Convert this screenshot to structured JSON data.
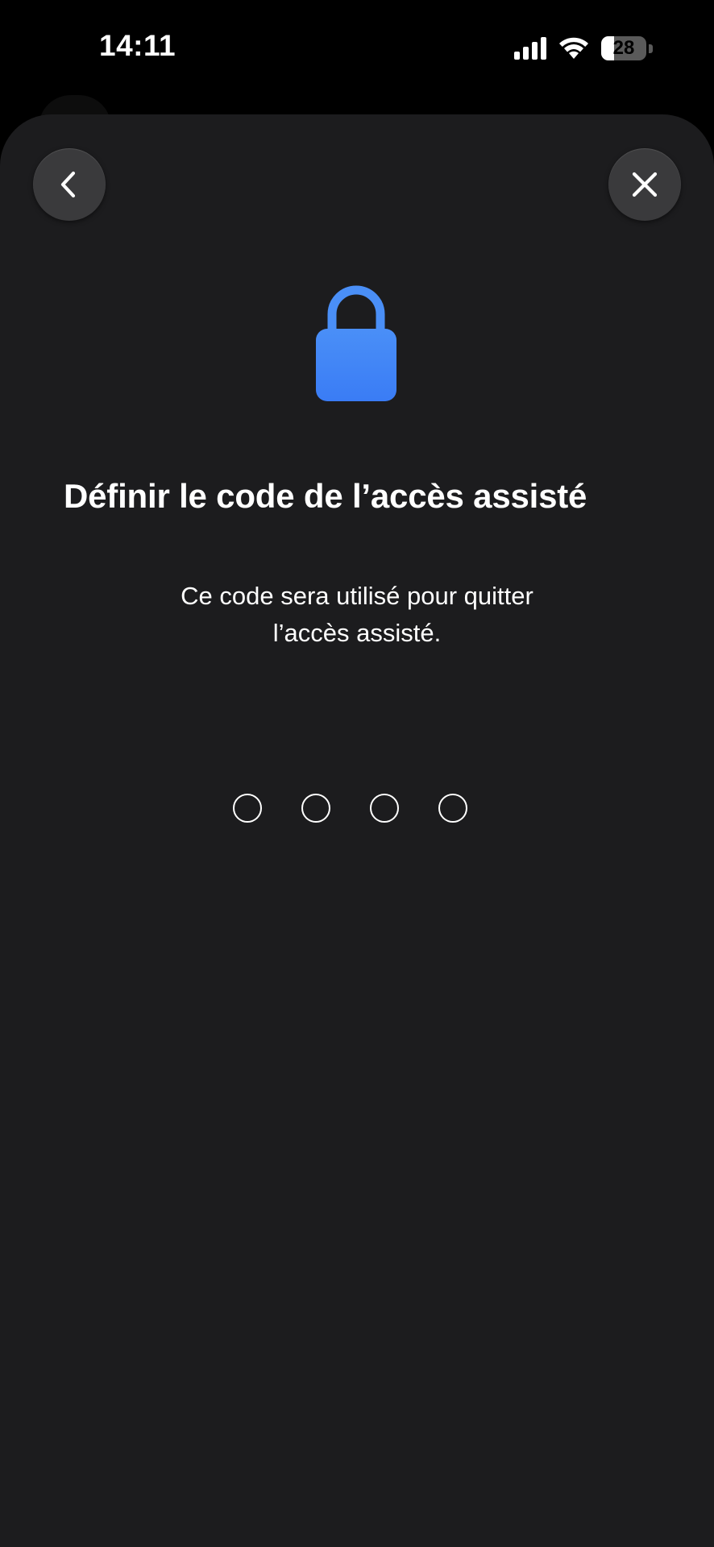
{
  "status_bar": {
    "time": "14:11",
    "battery_level": "28",
    "battery_fraction": 0.28,
    "icons": [
      "cellular-signal-icon",
      "wifi-icon",
      "battery-icon"
    ]
  },
  "nav": {
    "back_icon": "chevron-left-icon",
    "close_icon": "xmark-icon"
  },
  "hero": {
    "icon": "lock-icon",
    "icon_color": "#3d82f6"
  },
  "content": {
    "title": "Définir le code de l’accès assisté",
    "subtitle_line1": "Ce code sera utilisé pour quitter",
    "subtitle_line2": "l’accès assisté."
  },
  "passcode": {
    "length": 4,
    "entered": 0
  },
  "colors": {
    "background": "#000000",
    "sheet": "#1c1c1e",
    "button": "#3a3a3c",
    "accent": "#3d82f6"
  }
}
